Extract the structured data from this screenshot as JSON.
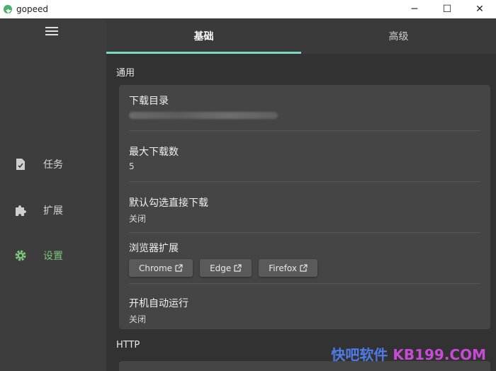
{
  "app": {
    "title": "gopeed",
    "icon": "gopeed-logo-icon"
  },
  "window_controls": {
    "minimize": "─",
    "maximize": "☐",
    "close": "✕"
  },
  "sidebar": {
    "items": [
      {
        "label": "任务",
        "icon": "task-file-icon",
        "active": false
      },
      {
        "label": "扩展",
        "icon": "puzzle-extension-icon",
        "active": false
      },
      {
        "label": "设置",
        "icon": "settings-gear-icon",
        "active": true
      }
    ]
  },
  "tabs": [
    {
      "label": "基础",
      "active": true
    },
    {
      "label": "高级",
      "active": false
    }
  ],
  "sections": {
    "general": "通用",
    "http": "HTTP"
  },
  "settings": {
    "download_dir": {
      "title": "下载目录",
      "value": ""
    },
    "max_downloads": {
      "title": "最大下载数",
      "value": "5"
    },
    "default_select_download": {
      "title": "默认勾选直接下载",
      "value": "关闭"
    },
    "browser_extension": {
      "title": "浏览器扩展",
      "buttons": [
        {
          "label": "Chrome"
        },
        {
          "label": "Edge"
        },
        {
          "label": "Firefox"
        }
      ]
    },
    "autostart": {
      "title": "开机自动运行",
      "value": "关闭"
    }
  },
  "watermark": {
    "cn": "快吧软件",
    "en": " KB199.COM"
  },
  "colors": {
    "accent": "#7ad8c8",
    "active_nav": "#7cc47c",
    "background": "#323232",
    "card": "#454545"
  }
}
